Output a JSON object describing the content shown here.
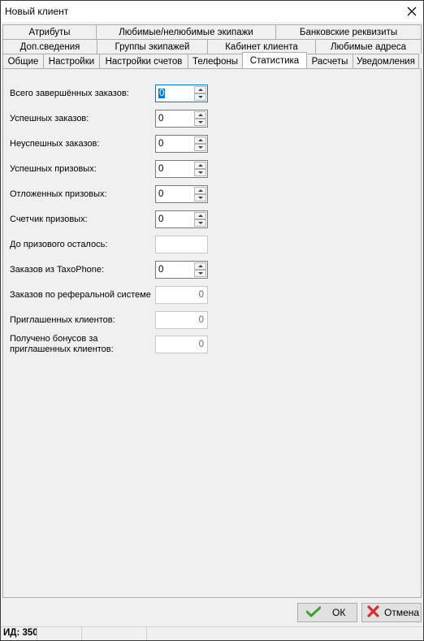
{
  "window": {
    "title": "Новый клиент"
  },
  "tabs": {
    "row1": [
      "Атрибуты",
      "Любимые/нелюбимые экипажи",
      "Банковские реквизиты"
    ],
    "row2": [
      "Доп.сведения",
      "Группы экипажей",
      "Кабинет клиента",
      "Любимые адреса"
    ],
    "row3": [
      "Общие",
      "Настройки",
      "Настройки счетов",
      "Телефоны",
      "Статистика",
      "Расчеты",
      "Уведомления"
    ],
    "active": "Статистика"
  },
  "stats": {
    "completed": {
      "label": "Всего завершённых заказов:",
      "value": "0"
    },
    "successful": {
      "label": "Успешных заказов:",
      "value": "0"
    },
    "unsuccessful": {
      "label": "Неуспешных заказов:",
      "value": "0"
    },
    "successful_prize": {
      "label": "Успешных призовых:",
      "value": "0"
    },
    "deferred_prize": {
      "label": "Отложенных призовых:",
      "value": "0"
    },
    "prize_counter": {
      "label": "Счетчик призовых:",
      "value": "0"
    },
    "until_prize": {
      "label": "До призового осталось:",
      "value": ""
    },
    "taxophone": {
      "label": "Заказов из TaxoPhone:",
      "value": "0"
    },
    "referral": {
      "label": "Заказов по реферальной системе",
      "value": "0"
    },
    "invited": {
      "label": "Приглашенных клиентов:",
      "value": "0"
    },
    "bonus_line1": "Получено бонусов за",
    "bonus_line2": "приглашенных клиентов:",
    "bonus_value": "0"
  },
  "buttons": {
    "ok": "ОК",
    "cancel": "Отмена"
  },
  "status": {
    "id": "ИД: 350"
  },
  "icons": {
    "close": "close-icon",
    "ok": "checkmark-icon",
    "cancel": "cancel-x-icon"
  },
  "colors": {
    "accent": "#0078d7",
    "ok_green": "#3aa52c",
    "cancel_red": "#d9302a"
  }
}
